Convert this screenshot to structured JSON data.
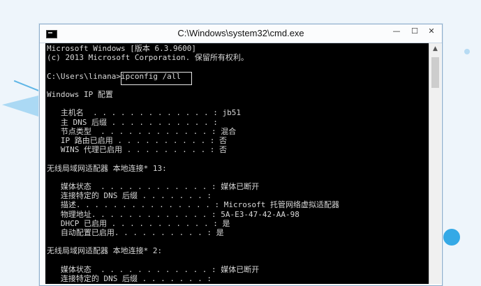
{
  "window": {
    "title": "C:\\Windows\\system32\\cmd.exe",
    "controls": {
      "minimize": "—",
      "maximize": "☐",
      "close": "✕"
    }
  },
  "console_lines": [
    "Microsoft Windows [版本 6.3.9600]",
    "(c) 2013 Microsoft Corporation. 保留所有权利。",
    "",
    "C:\\Users\\linana>ipconfig /all",
    "",
    "Windows IP 配置",
    "",
    "   主机名  . . . . . . . . . . . . . : jb51",
    "   主 DNS 后缀 . . . . . . . . . . . :",
    "   节点类型  . . . . . . . . . . . . : 混合",
    "   IP 路由已启用 . . . . . . . . . . : 否",
    "   WINS 代理已启用 . . . . . . . . . : 否",
    "",
    "无线局域网适配器 本地连接* 13:",
    "",
    "   媒体状态  . . . . . . . . . . . . : 媒体已断开",
    "   连接特定的 DNS 后缀 . . . . . . . :",
    "   描述. . . . . . . . . . . . . . . : Microsoft 托管网络虚拟适配器",
    "   物理地址. . . . . . . . . . . . . : 5A-E3-47-42-AA-98",
    "   DHCP 已启用 . . . . . . . . . . . : 是",
    "   自动配置已启用. . . . . . . . . . : 是",
    "",
    "无线局域网适配器 本地连接* 2:",
    "",
    "   媒体状态  . . . . . . . . . . . . : 媒体已断开",
    "   连接特定的 DNS 后缀 . . . . . . . :"
  ]
}
